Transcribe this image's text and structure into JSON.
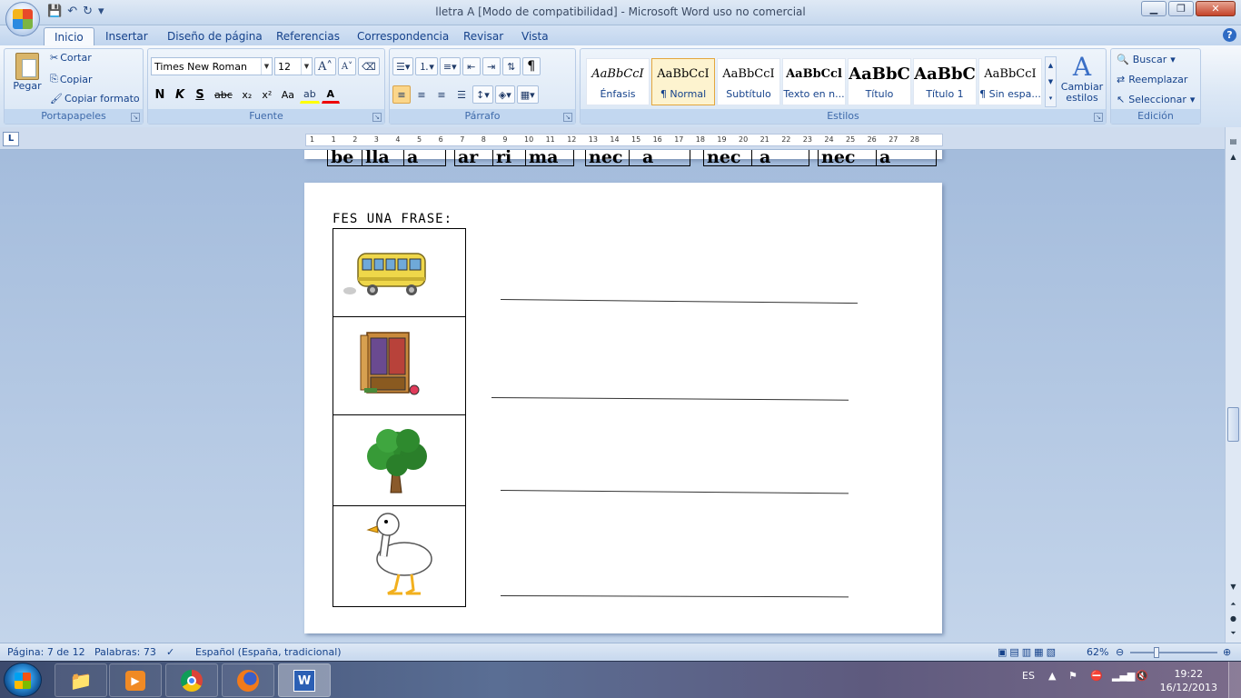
{
  "window": {
    "title": "lletra A [Modo de compatibilidad] - Microsoft Word uso no comercial",
    "minimize": "▁",
    "maximize": "❐",
    "close": "✕"
  },
  "tabs": [
    "Inicio",
    "Insertar",
    "Diseño de página",
    "Referencias",
    "Correspondencia",
    "Revisar",
    "Vista"
  ],
  "ribbon": {
    "clipboard": {
      "label": "Portapapeles",
      "paste": "Pegar",
      "cut": "Cortar",
      "copy": "Copiar",
      "format_painter": "Copiar formato"
    },
    "font": {
      "label": "Fuente",
      "family": "Times New Roman",
      "size": "12",
      "grow": "A",
      "shrink": "A",
      "bold": "N",
      "italic": "K",
      "underline": "S",
      "strike": "abc",
      "sub": "x₂",
      "sup": "x²",
      "case": "Aa"
    },
    "paragraph": {
      "label": "Párrafo",
      "pilcrow": "¶"
    },
    "styles": {
      "label": "Estilos",
      "items": [
        {
          "sample": "AaBbCcI",
          "name": "Énfasis"
        },
        {
          "sample": "AaBbCcI",
          "name": "¶ Normal"
        },
        {
          "sample": "AaBbCcI",
          "name": "Subtítulo"
        },
        {
          "sample": "AaBbCcl",
          "name": "Texto en n..."
        },
        {
          "sample": "AaBbC",
          "name": "Título"
        },
        {
          "sample": "AaBbC",
          "name": "Título 1"
        },
        {
          "sample": "AaBbCcI",
          "name": "¶ Sin espa..."
        }
      ],
      "change_styles": "Cambiar estilos"
    },
    "editing": {
      "label": "Edición",
      "find": "Buscar",
      "replace": "Reemplazar",
      "select": "Seleccionar"
    }
  },
  "ruler": {
    "marks": [
      "1",
      "1",
      "2",
      "3",
      "4",
      "5",
      "6",
      "7",
      "8",
      "9",
      "10",
      "11",
      "12",
      "13",
      "14",
      "15",
      "16",
      "17",
      "18",
      "19",
      "20",
      "21",
      "22",
      "23",
      "24",
      "25",
      "26",
      "27",
      "28"
    ]
  },
  "document": {
    "word_cells": [
      [
        "be",
        "lla",
        "a"
      ],
      [
        "ar",
        "ri",
        "ma"
      ],
      [
        "nec",
        "a"
      ],
      [
        "nec",
        "a"
      ],
      [
        "nec",
        "a"
      ]
    ],
    "heading": "FES UNA FRASE:",
    "pictures": [
      "bus-icon",
      "wardrobe-icon",
      "tree-icon",
      "duck-icon"
    ]
  },
  "status": {
    "page": "Página: 7 de 12",
    "words": "Palabras: 73",
    "language": "Español (España, tradicional)",
    "zoom": "62%"
  },
  "taskbar": {
    "language": "ES",
    "time": "19:22",
    "date": "16/12/2013"
  }
}
